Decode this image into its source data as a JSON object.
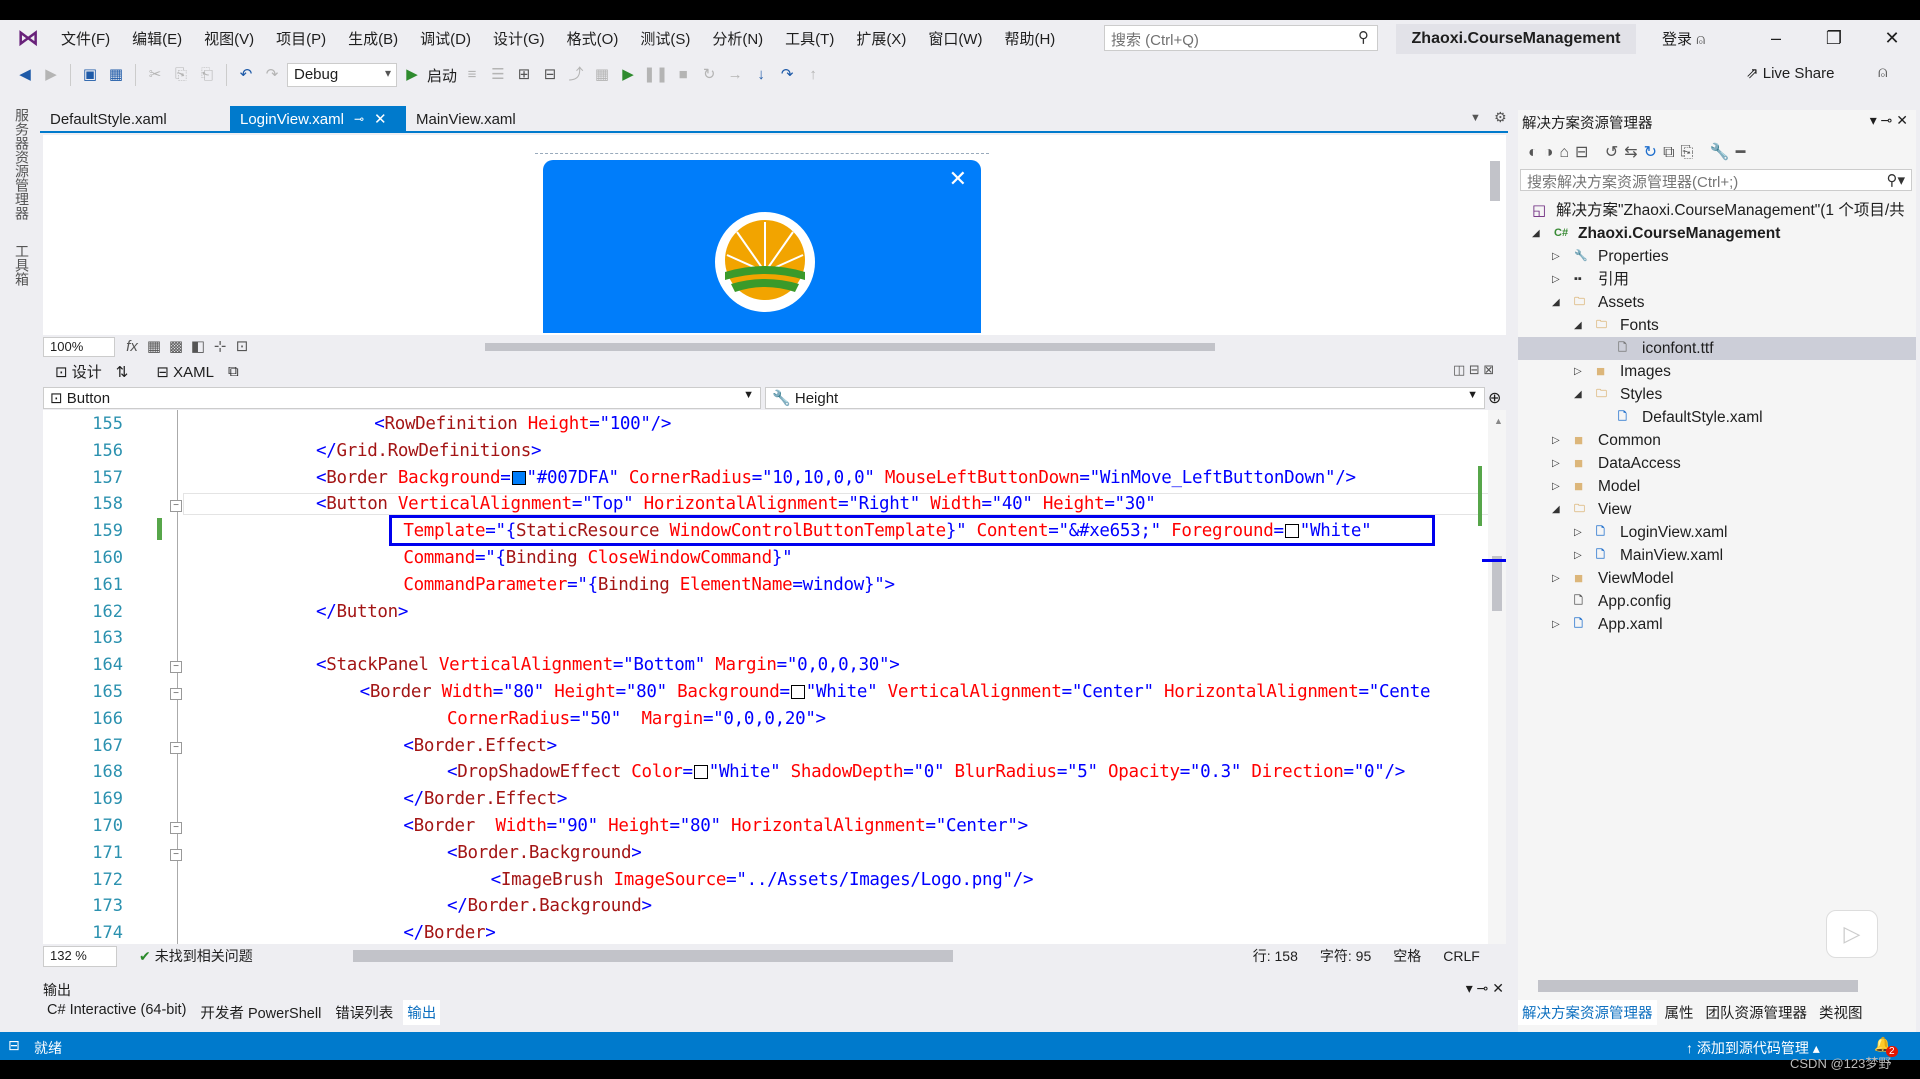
{
  "menu": {
    "items": [
      "文件(F)",
      "编辑(E)",
      "视图(V)",
      "项目(P)",
      "生成(B)",
      "调试(D)",
      "设计(G)",
      "格式(O)",
      "测试(S)",
      "分析(N)",
      "工具(T)",
      "扩展(X)",
      "窗口(W)",
      "帮助(H)"
    ],
    "search_placeholder": "搜索 (Ctrl+Q)",
    "project_name": "Zhaoxi.CourseManagement",
    "login": "登录"
  },
  "toolbar": {
    "config": "Debug",
    "start": "启动",
    "live_share": "Live Share"
  },
  "left_strip": {
    "server_explorer": "服务器资源管理器",
    "toolbox": "工具箱"
  },
  "tabs": [
    {
      "label": "DefaultStyle.xaml",
      "active": false
    },
    {
      "label": "LoginView.xaml",
      "active": true
    },
    {
      "label": "MainView.xaml",
      "active": false
    }
  ],
  "designer": {
    "zoom": "100%",
    "preview_color": "#007DFA",
    "view_design": "设计",
    "view_xaml": "XAML"
  },
  "nav": {
    "element": "Button",
    "property": "Height"
  },
  "code": {
    "lines": [
      {
        "n": 155,
        "indent": 4,
        "fold": "",
        "tokens": [
          [
            "punc",
            "<"
          ],
          [
            "tag",
            "RowDefinition"
          ],
          [
            "attr",
            " Height"
          ],
          [
            "punc",
            "=\""
          ],
          [
            "val",
            "100"
          ],
          [
            "punc",
            "\"/>"
          ]
        ]
      },
      {
        "n": 156,
        "indent": 0,
        "fold": "",
        "tokens": [
          [
            "punc",
            "</"
          ],
          [
            "tag",
            "Grid.RowDefinitions"
          ],
          [
            "punc",
            ">"
          ]
        ]
      },
      {
        "n": 157,
        "indent": 0,
        "fold": "",
        "tokens": [
          [
            "punc",
            "<"
          ],
          [
            "tag",
            "Border"
          ],
          [
            "attr",
            " Background"
          ],
          [
            "punc",
            "="
          ],
          [
            "swatch",
            "#007DFA"
          ],
          [
            "punc",
            "\""
          ],
          [
            "val",
            "#007DFA"
          ],
          [
            "punc",
            "\""
          ],
          [
            "attr",
            " CornerRadius"
          ],
          [
            "punc",
            "=\""
          ],
          [
            "val",
            "10,10,0,0"
          ],
          [
            "punc",
            "\""
          ],
          [
            "attr",
            " MouseLeftButtonDown"
          ],
          [
            "punc",
            "=\""
          ],
          [
            "val",
            "WinMove_LeftButtonDown"
          ],
          [
            "punc",
            "\"/>"
          ]
        ]
      },
      {
        "n": 158,
        "indent": 0,
        "fold": "-",
        "tokens": [
          [
            "punc",
            "<"
          ],
          [
            "tag",
            "Button"
          ],
          [
            "attr",
            " VerticalAlignment"
          ],
          [
            "punc",
            "=\""
          ],
          [
            "val",
            "Top"
          ],
          [
            "punc",
            "\""
          ],
          [
            "attr",
            " HorizontalAlignment"
          ],
          [
            "punc",
            "=\""
          ],
          [
            "val",
            "Right"
          ],
          [
            "punc",
            "\""
          ],
          [
            "attr",
            " Width"
          ],
          [
            "punc",
            "=\""
          ],
          [
            "val",
            "40"
          ],
          [
            "punc",
            "\""
          ],
          [
            "attr",
            " Height"
          ],
          [
            "punc",
            "=\""
          ],
          [
            "val",
            "30"
          ],
          [
            "punc",
            "\""
          ]
        ]
      },
      {
        "n": 159,
        "indent": 6,
        "fold": "",
        "tokens": [
          [
            "attr",
            "Template"
          ],
          [
            "punc",
            "=\"{"
          ],
          [
            "tag",
            "StaticResource"
          ],
          [
            "attr",
            " WindowControlButtonTemplate"
          ],
          [
            "punc",
            "}\""
          ],
          [
            "attr",
            " Content"
          ],
          [
            "punc",
            "=\""
          ],
          [
            "val",
            "&#xe653;"
          ],
          [
            "punc",
            "\""
          ],
          [
            "attr",
            " Foreground"
          ],
          [
            "punc",
            "="
          ],
          [
            "swatch",
            "#FFFFFF"
          ],
          [
            "punc",
            "\""
          ],
          [
            "val",
            "White"
          ],
          [
            "punc",
            "\""
          ]
        ]
      },
      {
        "n": 160,
        "indent": 6,
        "fold": "",
        "tokens": [
          [
            "attr",
            "Command"
          ],
          [
            "punc",
            "=\"{"
          ],
          [
            "tag",
            "Binding"
          ],
          [
            "attr",
            " CloseWindowCommand"
          ],
          [
            "punc",
            "}\""
          ]
        ]
      },
      {
        "n": 161,
        "indent": 6,
        "fold": "",
        "tokens": [
          [
            "attr",
            "CommandParameter"
          ],
          [
            "punc",
            "=\"{"
          ],
          [
            "tag",
            "Binding"
          ],
          [
            "attr",
            " ElementName"
          ],
          [
            "punc",
            "="
          ],
          [
            "val",
            "window"
          ],
          [
            "punc",
            "}\">"
          ]
        ]
      },
      {
        "n": 162,
        "indent": 0,
        "fold": "",
        "tokens": [
          [
            "punc",
            "</"
          ],
          [
            "tag",
            "Button"
          ],
          [
            "punc",
            ">"
          ]
        ]
      },
      {
        "n": 163,
        "indent": 0,
        "fold": "",
        "tokens": []
      },
      {
        "n": 164,
        "indent": 0,
        "fold": "-",
        "tokens": [
          [
            "punc",
            "<"
          ],
          [
            "tag",
            "StackPanel"
          ],
          [
            "attr",
            " VerticalAlignment"
          ],
          [
            "punc",
            "=\""
          ],
          [
            "val",
            "Bottom"
          ],
          [
            "punc",
            "\""
          ],
          [
            "attr",
            " Margin"
          ],
          [
            "punc",
            "=\""
          ],
          [
            "val",
            "0,0,0,30"
          ],
          [
            "punc",
            "\">"
          ]
        ]
      },
      {
        "n": 165,
        "indent": 3,
        "fold": "-",
        "tokens": [
          [
            "punc",
            "<"
          ],
          [
            "tag",
            "Border"
          ],
          [
            "attr",
            " Width"
          ],
          [
            "punc",
            "=\""
          ],
          [
            "val",
            "80"
          ],
          [
            "punc",
            "\""
          ],
          [
            "attr",
            " Height"
          ],
          [
            "punc",
            "=\""
          ],
          [
            "val",
            "80"
          ],
          [
            "punc",
            "\""
          ],
          [
            "attr",
            " Background"
          ],
          [
            "punc",
            "="
          ],
          [
            "swatch",
            "#FFFFFF"
          ],
          [
            "punc",
            "\""
          ],
          [
            "val",
            "White"
          ],
          [
            "punc",
            "\""
          ],
          [
            "attr",
            " VerticalAlignment"
          ],
          [
            "punc",
            "=\""
          ],
          [
            "val",
            "Center"
          ],
          [
            "punc",
            "\""
          ],
          [
            "attr",
            " HorizontalAlignment"
          ],
          [
            "punc",
            "=\""
          ],
          [
            "val",
            "Cente"
          ]
        ]
      },
      {
        "n": 166,
        "indent": 9,
        "fold": "",
        "tokens": [
          [
            "attr",
            "CornerRadius"
          ],
          [
            "punc",
            "=\""
          ],
          [
            "val",
            "50"
          ],
          [
            "punc",
            "\""
          ],
          [
            "attr",
            "  Margin"
          ],
          [
            "punc",
            "=\""
          ],
          [
            "val",
            "0,0,0,20"
          ],
          [
            "punc",
            "\">"
          ]
        ]
      },
      {
        "n": 167,
        "indent": 6,
        "fold": "-",
        "tokens": [
          [
            "punc",
            "<"
          ],
          [
            "tag",
            "Border.Effect"
          ],
          [
            "punc",
            ">"
          ]
        ]
      },
      {
        "n": 168,
        "indent": 9,
        "fold": "",
        "tokens": [
          [
            "punc",
            "<"
          ],
          [
            "tag",
            "DropShadowEffect"
          ],
          [
            "attr",
            " Color"
          ],
          [
            "punc",
            "="
          ],
          [
            "swatch",
            "#FFFFFF"
          ],
          [
            "punc",
            "\""
          ],
          [
            "val",
            "White"
          ],
          [
            "punc",
            "\""
          ],
          [
            "attr",
            " ShadowDepth"
          ],
          [
            "punc",
            "=\""
          ],
          [
            "val",
            "0"
          ],
          [
            "punc",
            "\""
          ],
          [
            "attr",
            " BlurRadius"
          ],
          [
            "punc",
            "=\""
          ],
          [
            "val",
            "5"
          ],
          [
            "punc",
            "\""
          ],
          [
            "attr",
            " Opacity"
          ],
          [
            "punc",
            "=\""
          ],
          [
            "val",
            "0.3"
          ],
          [
            "punc",
            "\""
          ],
          [
            "attr",
            " Direction"
          ],
          [
            "punc",
            "=\""
          ],
          [
            "val",
            "0"
          ],
          [
            "punc",
            "\"/>"
          ]
        ]
      },
      {
        "n": 169,
        "indent": 6,
        "fold": "",
        "tokens": [
          [
            "punc",
            "</"
          ],
          [
            "tag",
            "Border.Effect"
          ],
          [
            "punc",
            ">"
          ]
        ]
      },
      {
        "n": 170,
        "indent": 6,
        "fold": "-",
        "tokens": [
          [
            "punc",
            "<"
          ],
          [
            "tag",
            "Border"
          ],
          [
            "attr",
            "  Width"
          ],
          [
            "punc",
            "=\""
          ],
          [
            "val",
            "90"
          ],
          [
            "punc",
            "\""
          ],
          [
            "attr",
            " Height"
          ],
          [
            "punc",
            "=\""
          ],
          [
            "val",
            "80"
          ],
          [
            "punc",
            "\""
          ],
          [
            "attr",
            " HorizontalAlignment"
          ],
          [
            "punc",
            "=\""
          ],
          [
            "val",
            "Center"
          ],
          [
            "punc",
            "\">"
          ]
        ]
      },
      {
        "n": 171,
        "indent": 9,
        "fold": "-",
        "tokens": [
          [
            "punc",
            "<"
          ],
          [
            "tag",
            "Border.Background"
          ],
          [
            "punc",
            ">"
          ]
        ]
      },
      {
        "n": 172,
        "indent": 12,
        "fold": "",
        "tokens": [
          [
            "punc",
            "<"
          ],
          [
            "tag",
            "ImageBrush"
          ],
          [
            "attr",
            " ImageSource"
          ],
          [
            "punc",
            "=\""
          ],
          [
            "val",
            "../Assets/Images/Logo.png"
          ],
          [
            "punc",
            "\"/>"
          ]
        ]
      },
      {
        "n": 173,
        "indent": 9,
        "fold": "",
        "tokens": [
          [
            "punc",
            "</"
          ],
          [
            "tag",
            "Border.Background"
          ],
          [
            "punc",
            ">"
          ]
        ]
      },
      {
        "n": 174,
        "indent": 6,
        "fold": "",
        "tokens": [
          [
            "punc",
            "</"
          ],
          [
            "tag",
            "Border"
          ],
          [
            "punc",
            ">"
          ]
        ]
      }
    ]
  },
  "editor_status": {
    "zoom": "132 %",
    "issues": "未找到相关问题",
    "line": "行: 158",
    "char": "字符: 95",
    "spaces": "空格",
    "eol": "CRLF"
  },
  "output": {
    "title": "输出",
    "tabs": [
      "C# Interactive (64-bit)",
      "开发者 PowerShell",
      "错误列表",
      "输出"
    ]
  },
  "solution_explorer": {
    "title": "解决方案资源管理器",
    "search_placeholder": "搜索解决方案资源管理器(Ctrl+;)",
    "tree": [
      {
        "label": "解决方案\"Zhaoxi.CourseManagement\"(1 个项目/共",
        "level": 0,
        "arrow": "",
        "icon": "solution-icon",
        "bold": false
      },
      {
        "label": "Zhaoxi.CourseManagement",
        "level": 0,
        "arrow": "open",
        "icon": "csharp-project-icon",
        "bold": true
      },
      {
        "label": "Properties",
        "level": 1,
        "arrow": "closed",
        "icon": "wrench-icon"
      },
      {
        "label": "引用",
        "level": 1,
        "arrow": "closed",
        "icon": "references-icon"
      },
      {
        "label": "Assets",
        "level": 1,
        "arrow": "open",
        "icon": "folder-open-icon"
      },
      {
        "label": "Fonts",
        "level": 2,
        "arrow": "open",
        "icon": "folder-open-icon"
      },
      {
        "label": "iconfont.ttf",
        "level": 3,
        "arrow": "",
        "icon": "font-file-icon",
        "selected": true
      },
      {
        "label": "Images",
        "level": 2,
        "arrow": "closed",
        "icon": "folder-icon"
      },
      {
        "label": "Styles",
        "level": 2,
        "arrow": "open",
        "icon": "folder-open-icon"
      },
      {
        "label": "DefaultStyle.xaml",
        "level": 3,
        "arrow": "",
        "icon": "xaml-file-icon"
      },
      {
        "label": "Common",
        "level": 1,
        "arrow": "closed",
        "icon": "folder-icon"
      },
      {
        "label": "DataAccess",
        "level": 1,
        "arrow": "closed",
        "icon": "folder-icon"
      },
      {
        "label": "Model",
        "level": 1,
        "arrow": "closed",
        "icon": "folder-icon"
      },
      {
        "label": "View",
        "level": 1,
        "arrow": "open",
        "icon": "folder-open-icon"
      },
      {
        "label": "LoginView.xaml",
        "level": 2,
        "arrow": "closed",
        "icon": "xaml-file-icon"
      },
      {
        "label": "MainView.xaml",
        "level": 2,
        "arrow": "closed",
        "icon": "xaml-file-icon"
      },
      {
        "label": "ViewModel",
        "level": 1,
        "arrow": "closed",
        "icon": "folder-icon"
      },
      {
        "label": "App.config",
        "level": 1,
        "arrow": "",
        "icon": "config-file-icon"
      },
      {
        "label": "App.xaml",
        "level": 1,
        "arrow": "closed",
        "icon": "xaml-file-icon"
      }
    ],
    "bottom_tabs": [
      "解决方案资源管理器",
      "属性",
      "团队资源管理器",
      "类视图"
    ]
  },
  "statusbar": {
    "ready": "就绪",
    "source_control": "添加到源代码管理",
    "notifications": "2",
    "watermark": "CSDN @123梦野"
  }
}
